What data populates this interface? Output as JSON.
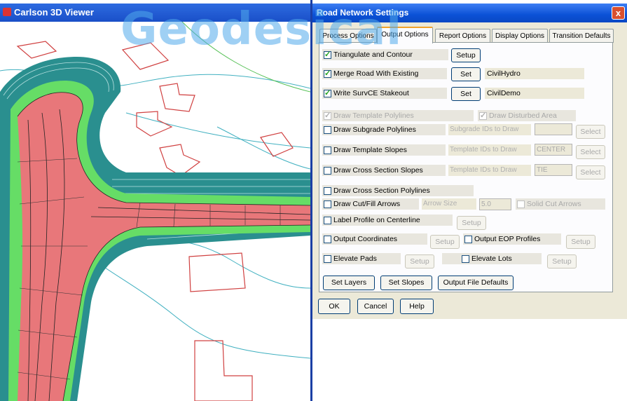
{
  "watermark": "Geodesical",
  "viewer": {
    "title": "Carlson 3D Viewer",
    "icon": "carlson-app-icon"
  },
  "dialog": {
    "title": "Road Network Settings",
    "close_label": "x",
    "tabs": [
      "Process Options",
      "Output Options",
      "Report Options",
      "Display Options",
      "Transition Defaults"
    ],
    "active_tab": "Output Options",
    "triangulate": {
      "label": "Triangulate and Contour",
      "checked": true,
      "button": "Setup"
    },
    "merge": {
      "label": "Merge Road With Existing",
      "checked": true,
      "button": "Set",
      "value": "CivilHydro"
    },
    "write_survce": {
      "label": "Write SurvCE Stakeout",
      "checked": true,
      "button": "Set",
      "value": "CivilDemo"
    },
    "draw_template_polylines": {
      "label": "Draw Template Polylines",
      "checked": true
    },
    "draw_disturbed_area": {
      "label": "Draw Disturbed Area",
      "checked": true
    },
    "subgrade": {
      "label": "Draw Subgrade Polylines",
      "field_label": "Subgrade IDs to Draw",
      "value": "",
      "button": "Select"
    },
    "template_slopes": {
      "label": "Draw Template Slopes",
      "field_label": "Template IDs to Draw",
      "value": "CENTER",
      "button": "Select"
    },
    "cross_section_slopes": {
      "label": "Draw Cross Section Slopes",
      "field_label": "Template IDs to Draw",
      "value": "TIE",
      "button": "Select"
    },
    "cross_section_polylines": {
      "label": "Draw Cross Section Polylines"
    },
    "cut_fill_arrows": {
      "label": "Draw Cut/Fill Arrows",
      "size_label": "Arrow Size",
      "size_value": "5.0",
      "solid_label": "Solid Cut Arrows"
    },
    "label_profile": {
      "label": "Label Profile on Centerline",
      "button": "Setup"
    },
    "output_coordinates": {
      "label": "Output Coordinates",
      "button": "Setup"
    },
    "output_eop": {
      "label": "Output EOP Profiles",
      "button": "Setup"
    },
    "elevate_pads": {
      "label": "Elevate Pads",
      "button": "Setup"
    },
    "elevate_lots": {
      "label": "Elevate Lots",
      "button": "Setup"
    },
    "bottom_buttons": {
      "set_layers": "Set Layers",
      "set_slopes": "Set Slopes",
      "output_file_defaults": "Output File Defaults"
    },
    "footer": {
      "ok": "OK",
      "cancel": "Cancel",
      "help": "Help"
    }
  },
  "colors": {
    "road_surface": "#e8777a",
    "shoulder": "#66dd66",
    "slope": "#2a8f8f",
    "lot_outline": "#d04040",
    "contour": "#40b0c0"
  }
}
